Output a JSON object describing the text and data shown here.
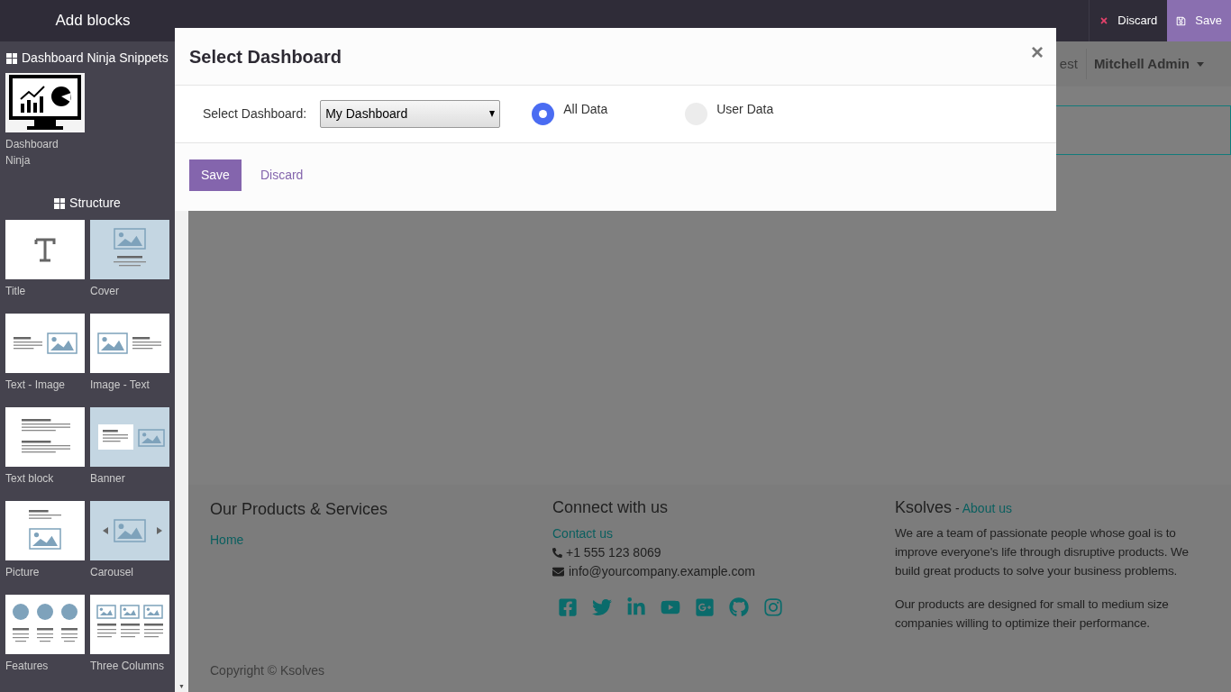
{
  "sidebar": {
    "title": "Add blocks",
    "sections": [
      {
        "heading": "Dashboard Ninja Snippets",
        "blocks": [
          {
            "kind": "monitor",
            "label": "Dashboard Ninja"
          }
        ]
      },
      {
        "heading": "Structure",
        "blocks": [
          {
            "kind": "title",
            "label": "Title"
          },
          {
            "kind": "cover",
            "label": "Cover"
          },
          {
            "kind": "text-image",
            "label": "Text - Image"
          },
          {
            "kind": "image-text",
            "label": "Image - Text"
          },
          {
            "kind": "text-block",
            "label": "Text block"
          },
          {
            "kind": "banner",
            "label": "Banner"
          },
          {
            "kind": "picture",
            "label": "Picture"
          },
          {
            "kind": "carousel",
            "label": "Carousel"
          },
          {
            "kind": "features",
            "label": "Features"
          },
          {
            "kind": "three-columns",
            "label": "Three Columns"
          }
        ]
      }
    ]
  },
  "scroll_arrow": "▼",
  "editor_bar": {
    "discard": "Discard",
    "save": "Save"
  },
  "user_bar": {
    "db_name": "est",
    "user": "Mitchell Admin"
  },
  "dialog": {
    "title": "Select Dashboard",
    "close": "×",
    "field_label": "Select Dashboard:",
    "select_value": "My Dashboard",
    "options": [
      {
        "label": "All Data",
        "selected": true
      },
      {
        "label": "User Data",
        "selected": false
      }
    ],
    "save": "Save",
    "discard": "Discard"
  },
  "footer": {
    "col1": {
      "heading": "Our Products & Services",
      "links": [
        "Home"
      ]
    },
    "col2": {
      "heading": "Connect with us",
      "link": "Contact us",
      "phone": "+1 555 123 8069",
      "email": "info@yourcompany.example.com",
      "socials": [
        {
          "kind": "facebook"
        },
        {
          "kind": "twitter"
        },
        {
          "kind": "linkedin"
        },
        {
          "kind": "youtube"
        },
        {
          "kind": "google-plus"
        },
        {
          "kind": "github"
        },
        {
          "kind": "instagram"
        }
      ]
    },
    "col3": {
      "heading": "Ksolves",
      "separator": "-",
      "link": "About us",
      "paragraphs": [
        "We are a team of passionate people whose goal is to improve everyone's life through disruptive products. We build great products to solve your business problems.",
        "Our products are designed for small to medium size companies willing to optimize their performance."
      ]
    },
    "copyright": "Copyright © Ksolves"
  }
}
